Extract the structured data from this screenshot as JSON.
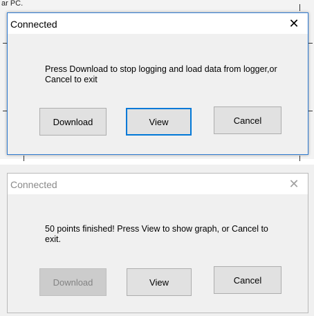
{
  "top_fragment": "ar PC.",
  "dialog1": {
    "title": "Connected",
    "close_glyph": "✕",
    "message": "Press Download to stop logging and load data from logger,or Cancel to exit",
    "buttons": {
      "download": "Download",
      "view": "View",
      "cancel": "Cancel"
    }
  },
  "dialog2": {
    "title": "Connected",
    "close_glyph": "✕",
    "message": "50 points finished! Press View to show graph, or Cancel to exit.",
    "buttons": {
      "download": "Download",
      "view": "View",
      "cancel": "Cancel"
    }
  },
  "colors": {
    "focus_border": "#0078d7",
    "button_face": "#e1e1e1",
    "disabled_face": "#cccccc",
    "disabled_text": "#838383"
  }
}
